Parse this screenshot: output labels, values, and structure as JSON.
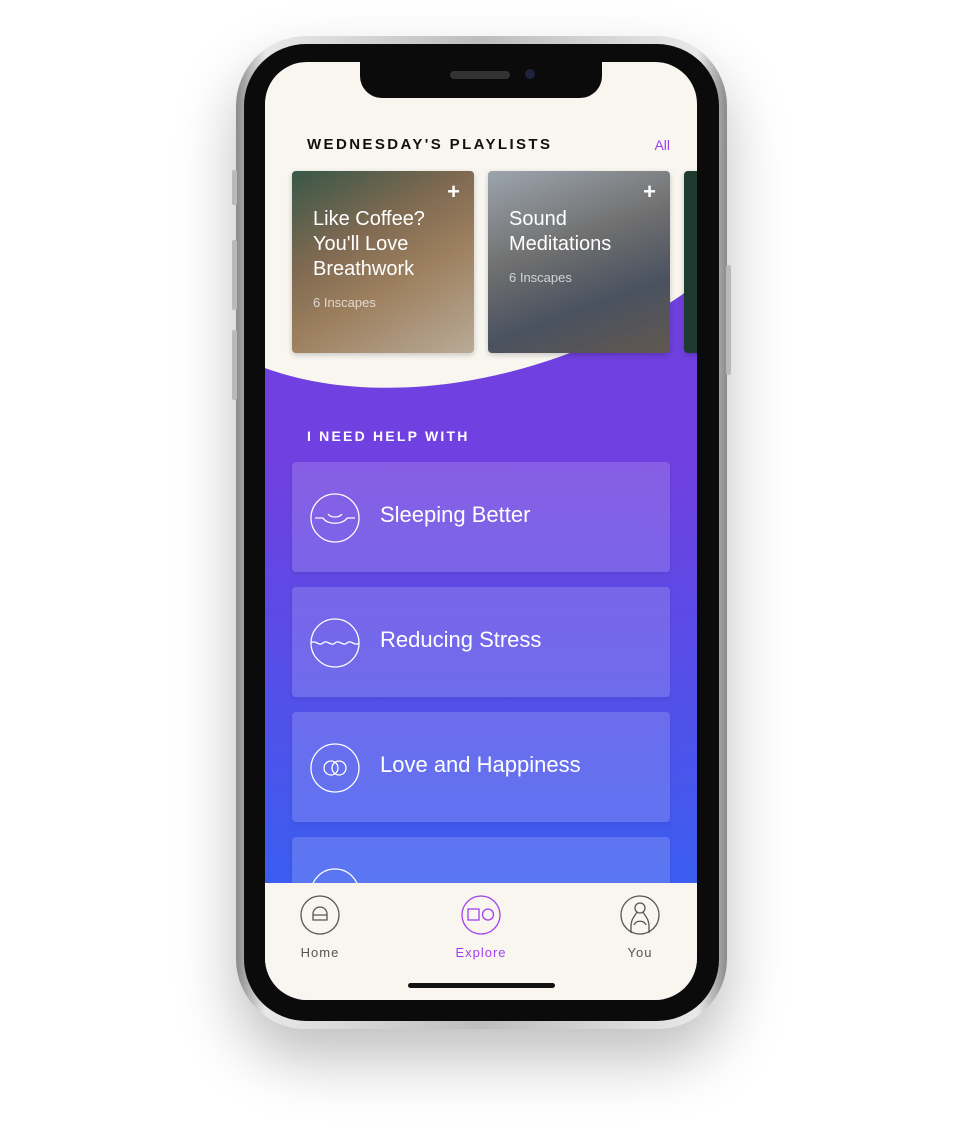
{
  "header": {
    "title": "WEDNESDAY'S PLAYLISTS",
    "all_link": "All"
  },
  "playlists": [
    {
      "title": "Like Coffee? You'll Love Breathwork",
      "subtitle": "6 Inscapes",
      "add_icon": "plus-icon"
    },
    {
      "title": "Sound Meditations",
      "subtitle": "6 Inscapes",
      "add_icon": "plus-icon"
    }
  ],
  "help": {
    "title": "I NEED HELP WITH",
    "items": [
      {
        "label": "Sleeping Better",
        "icon": "sleep-icon"
      },
      {
        "label": "Reducing Stress",
        "icon": "wave-icon"
      },
      {
        "label": "Love and Happiness",
        "icon": "rings-icon"
      },
      {
        "label": "",
        "icon": "mountain-icon"
      }
    ]
  },
  "tabbar": {
    "tabs": [
      {
        "label": "Home",
        "active": false
      },
      {
        "label": "Explore",
        "active": true
      },
      {
        "label": "You",
        "active": false
      }
    ]
  },
  "colors": {
    "accent": "#a040f0",
    "gradient_top": "#6f3fe0",
    "gradient_bottom": "#3a5ef0",
    "background": "#f9f6f0"
  }
}
